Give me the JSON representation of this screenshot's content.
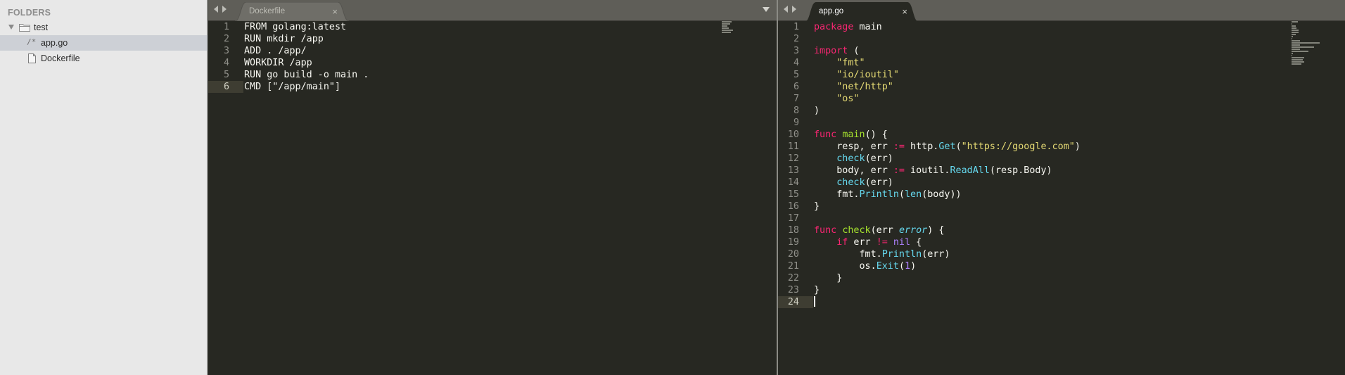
{
  "sidebar": {
    "heading": "FOLDERS",
    "items": [
      {
        "label": "test",
        "kind": "folder",
        "expanded": true
      },
      {
        "label": "app.go",
        "kind": "go-file",
        "selected": true
      },
      {
        "label": "Dockerfile",
        "kind": "file",
        "selected": false
      }
    ]
  },
  "panes": [
    {
      "tab": {
        "label": "Dockerfile",
        "close": "×",
        "active": false
      },
      "current_line": 6,
      "lines": [
        {
          "n": "1",
          "t": [
            [
              "p",
              "FROM golang:latest"
            ]
          ]
        },
        {
          "n": "2",
          "t": [
            [
              "p",
              "RUN mkdir /app"
            ]
          ]
        },
        {
          "n": "3",
          "t": [
            [
              "p",
              "ADD . /app/"
            ]
          ]
        },
        {
          "n": "4",
          "t": [
            [
              "p",
              "WORKDIR /app"
            ]
          ]
        },
        {
          "n": "5",
          "t": [
            [
              "p",
              "RUN go build -o main ."
            ]
          ]
        },
        {
          "n": "6",
          "t": [
            [
              "p",
              "CMD [\"/app/main\"]"
            ]
          ]
        }
      ]
    },
    {
      "tab": {
        "label": "app.go",
        "close": "×",
        "active": true
      },
      "current_line": 24,
      "lines": [
        {
          "n": "1",
          "t": [
            [
              "k",
              "package"
            ],
            [
              "p",
              " main"
            ]
          ]
        },
        {
          "n": "2",
          "t": []
        },
        {
          "n": "3",
          "t": [
            [
              "k",
              "import"
            ],
            [
              "p",
              " ("
            ]
          ]
        },
        {
          "n": "4",
          "t": [
            [
              "p",
              "    "
            ],
            [
              "s",
              "\"fmt\""
            ]
          ]
        },
        {
          "n": "5",
          "t": [
            [
              "p",
              "    "
            ],
            [
              "s",
              "\"io/ioutil\""
            ]
          ]
        },
        {
          "n": "6",
          "t": [
            [
              "p",
              "    "
            ],
            [
              "s",
              "\"net/http\""
            ]
          ]
        },
        {
          "n": "7",
          "t": [
            [
              "p",
              "    "
            ],
            [
              "s",
              "\"os\""
            ]
          ]
        },
        {
          "n": "8",
          "t": [
            [
              "p",
              ")"
            ]
          ]
        },
        {
          "n": "9",
          "t": []
        },
        {
          "n": "10",
          "t": [
            [
              "k",
              "func"
            ],
            [
              "p",
              " "
            ],
            [
              "f",
              "main"
            ],
            [
              "p",
              "() {"
            ]
          ]
        },
        {
          "n": "11",
          "t": [
            [
              "p",
              "    resp, err "
            ],
            [
              "k",
              ":="
            ],
            [
              "p",
              " http."
            ],
            [
              "c",
              "Get"
            ],
            [
              "p",
              "("
            ],
            [
              "s",
              "\"https://google.com\""
            ],
            [
              "p",
              ")"
            ]
          ]
        },
        {
          "n": "12",
          "t": [
            [
              "p",
              "    "
            ],
            [
              "c",
              "check"
            ],
            [
              "p",
              "(err)"
            ]
          ]
        },
        {
          "n": "13",
          "t": [
            [
              "p",
              "    body, err "
            ],
            [
              "k",
              ":="
            ],
            [
              "p",
              " ioutil."
            ],
            [
              "c",
              "ReadAll"
            ],
            [
              "p",
              "(resp.Body)"
            ]
          ]
        },
        {
          "n": "14",
          "t": [
            [
              "p",
              "    "
            ],
            [
              "c",
              "check"
            ],
            [
              "p",
              "(err)"
            ]
          ]
        },
        {
          "n": "15",
          "t": [
            [
              "p",
              "    fmt."
            ],
            [
              "c",
              "Println"
            ],
            [
              "p",
              "("
            ],
            [
              "c",
              "len"
            ],
            [
              "p",
              "(body))"
            ]
          ]
        },
        {
          "n": "16",
          "t": [
            [
              "p",
              "}"
            ]
          ]
        },
        {
          "n": "17",
          "t": []
        },
        {
          "n": "18",
          "t": [
            [
              "k",
              "func"
            ],
            [
              "p",
              " "
            ],
            [
              "f",
              "check"
            ],
            [
              "p",
              "(err "
            ],
            [
              "y",
              "error"
            ],
            [
              "p",
              ") {"
            ]
          ]
        },
        {
          "n": "19",
          "t": [
            [
              "p",
              "    "
            ],
            [
              "k",
              "if"
            ],
            [
              "p",
              " err "
            ],
            [
              "k",
              "!="
            ],
            [
              "p",
              " "
            ],
            [
              "m",
              "nil"
            ],
            [
              "p",
              " {"
            ]
          ]
        },
        {
          "n": "20",
          "t": [
            [
              "p",
              "        fmt."
            ],
            [
              "c",
              "Println"
            ],
            [
              "p",
              "(err)"
            ]
          ]
        },
        {
          "n": "21",
          "t": [
            [
              "p",
              "        os."
            ],
            [
              "c",
              "Exit"
            ],
            [
              "p",
              "("
            ],
            [
              "m",
              "1"
            ],
            [
              "p",
              ")"
            ]
          ]
        },
        {
          "n": "22",
          "t": [
            [
              "p",
              "    }"
            ]
          ]
        },
        {
          "n": "23",
          "t": [
            [
              "p",
              "}"
            ]
          ]
        },
        {
          "n": "24",
          "t": []
        }
      ]
    }
  ]
}
